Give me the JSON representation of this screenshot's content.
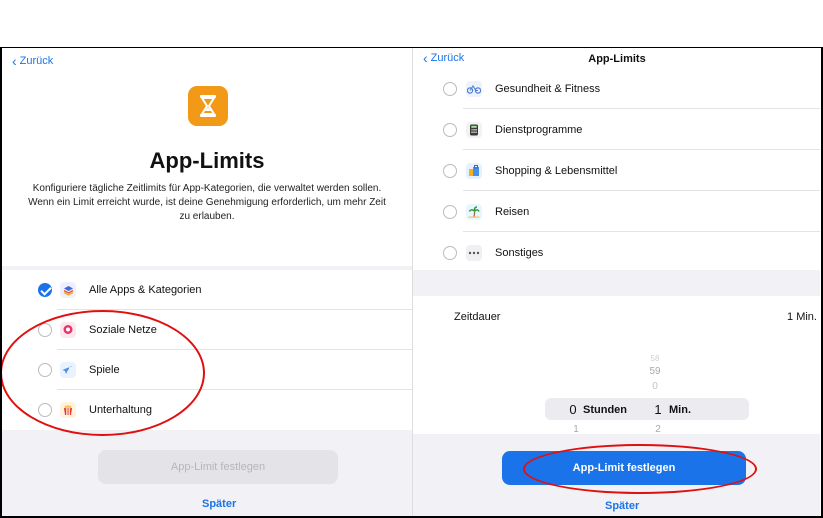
{
  "left_pane": {
    "back_label": "Zurück",
    "title": "App-Limits",
    "description": "Konfiguriere tägliche Zeitlimits für App-Kategorien, die verwaltet werden sollen. Wenn ein Limit erreicht wurde, ist deine Genehmigung erforderlich, um mehr Zeit zu erlauben.",
    "items": [
      {
        "label": "Alle Apps & Kategorien",
        "checked": true,
        "icon": "layers-icon"
      },
      {
        "label": "Soziale Netze",
        "checked": false,
        "icon": "chat-bubble-icon"
      },
      {
        "label": "Spiele",
        "checked": false,
        "icon": "rocket-icon"
      },
      {
        "label": "Unterhaltung",
        "checked": false,
        "icon": "popcorn-icon"
      }
    ],
    "set_limit_label": "App-Limit festlegen",
    "later_label": "Später"
  },
  "right_pane": {
    "back_label": "Zurück",
    "title": "App-Limits",
    "items": [
      {
        "label": "Gesundheit & Fitness",
        "icon": "bicycle-icon"
      },
      {
        "label": "Dienstprogramme",
        "icon": "calculator-icon"
      },
      {
        "label": "Shopping & Lebensmittel",
        "icon": "shopping-bag-icon"
      },
      {
        "label": "Reisen",
        "icon": "palm-tree-icon"
      },
      {
        "label": "Sonstiges",
        "icon": "ellipsis-icon"
      }
    ],
    "duration_label": "Zeitdauer",
    "duration_value": "1 Min.",
    "picker": {
      "hours_above": [
        "",
        "",
        ""
      ],
      "minutes_above": [
        "58",
        "59",
        "0"
      ],
      "hours_selected": "0",
      "hours_unit": "Stunden",
      "minutes_selected": "1",
      "minutes_unit": "Min.",
      "hours_below": "1",
      "minutes_below": "2"
    },
    "set_limit_label": "App-Limit festlegen",
    "later_label": "Später"
  },
  "colors": {
    "accent": "#1a73e8",
    "hero_icon_bg": "#f29a18",
    "annotation": "#e01010"
  }
}
